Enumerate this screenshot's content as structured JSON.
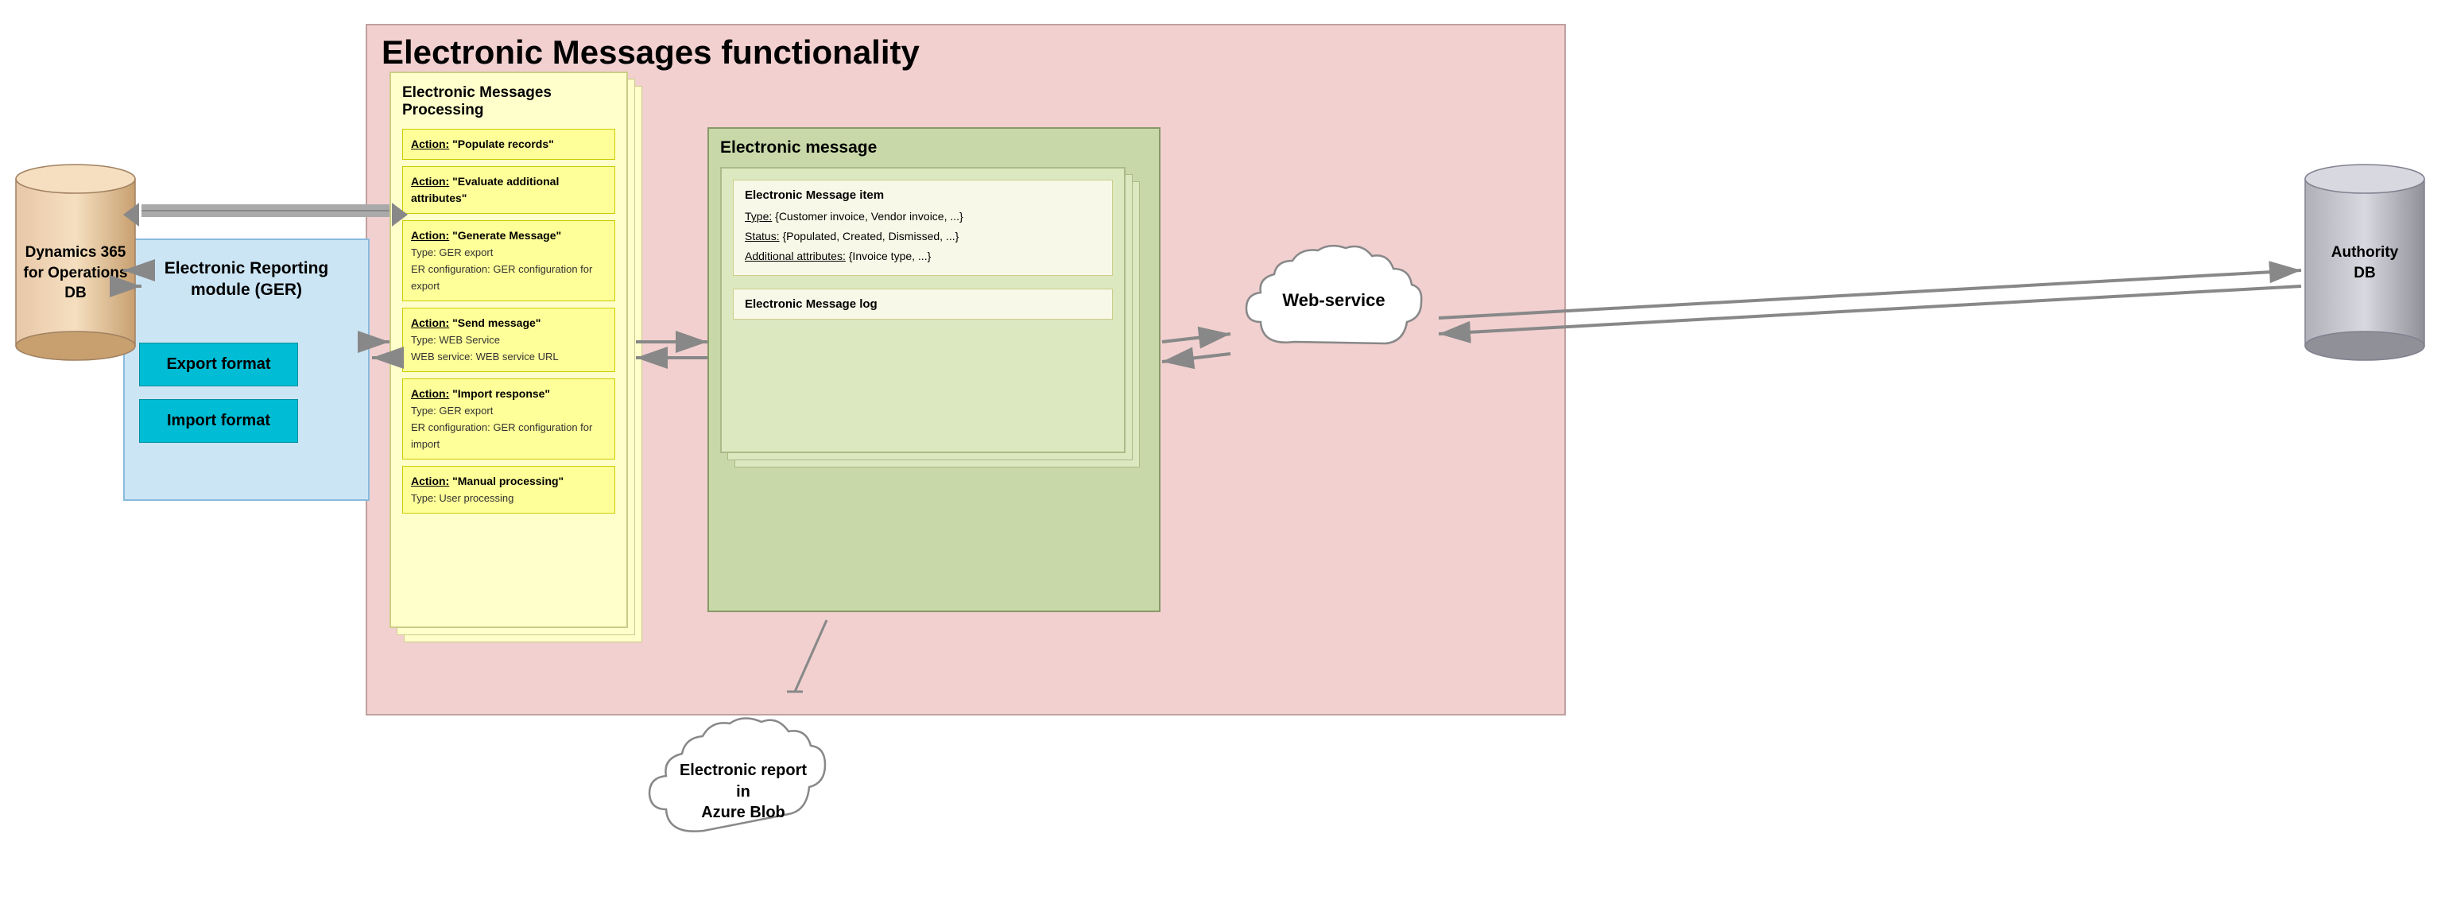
{
  "title": "Electronic Messages functionality",
  "em_functionality": {
    "title": "Electronic Messages functionality"
  },
  "er_module": {
    "title": "Electronic Reporting module (GER)",
    "export_format": "Export format",
    "import_format": "Import format"
  },
  "em_processing": {
    "title": "Electronic Messages Processing",
    "actions": [
      {
        "label": "Action:",
        "value": "\"Populate records\"",
        "details": []
      },
      {
        "label": "Action:",
        "value": "\"Evaluate additional attributes\"",
        "details": []
      },
      {
        "label": "Action:",
        "value": "\"Generate Message\"",
        "details": [
          "Type: GER export",
          "ER configuration: GER configuration for export"
        ]
      },
      {
        "label": "Action:",
        "value": "\"Send message\"",
        "details": [
          "Type: WEB Service",
          "WEB service: WEB service URL"
        ]
      },
      {
        "label": "Action:",
        "value": "\"Import response\"",
        "details": [
          "Type: GER export",
          "ER configuration: GER configuration for import"
        ]
      },
      {
        "label": "Action:",
        "value": "\"Manual processing\"",
        "details": [
          "Type: User processing"
        ]
      }
    ]
  },
  "em_message": {
    "title": "Electronic message",
    "item_box": {
      "title": "Electronic Message item",
      "type_label": "Type:",
      "type_value": "{Customer invoice, Vendor invoice, ...}",
      "status_label": "Status:",
      "status_value": "{Populated, Created, Dismissed, ...}",
      "additional_label": "Additional attributes:",
      "additional_value": "{Invoice type, ...}"
    },
    "log_box": {
      "title": "Electronic Message log"
    }
  },
  "dynamics_db": {
    "label": "Dynamics 365\nfor Operations\nDB"
  },
  "authority_db": {
    "label": "Authority\nDB"
  },
  "webservice": {
    "label": "Web-service"
  },
  "report_cloud": {
    "label": "Electronic report\nin\nAzure Blob"
  }
}
